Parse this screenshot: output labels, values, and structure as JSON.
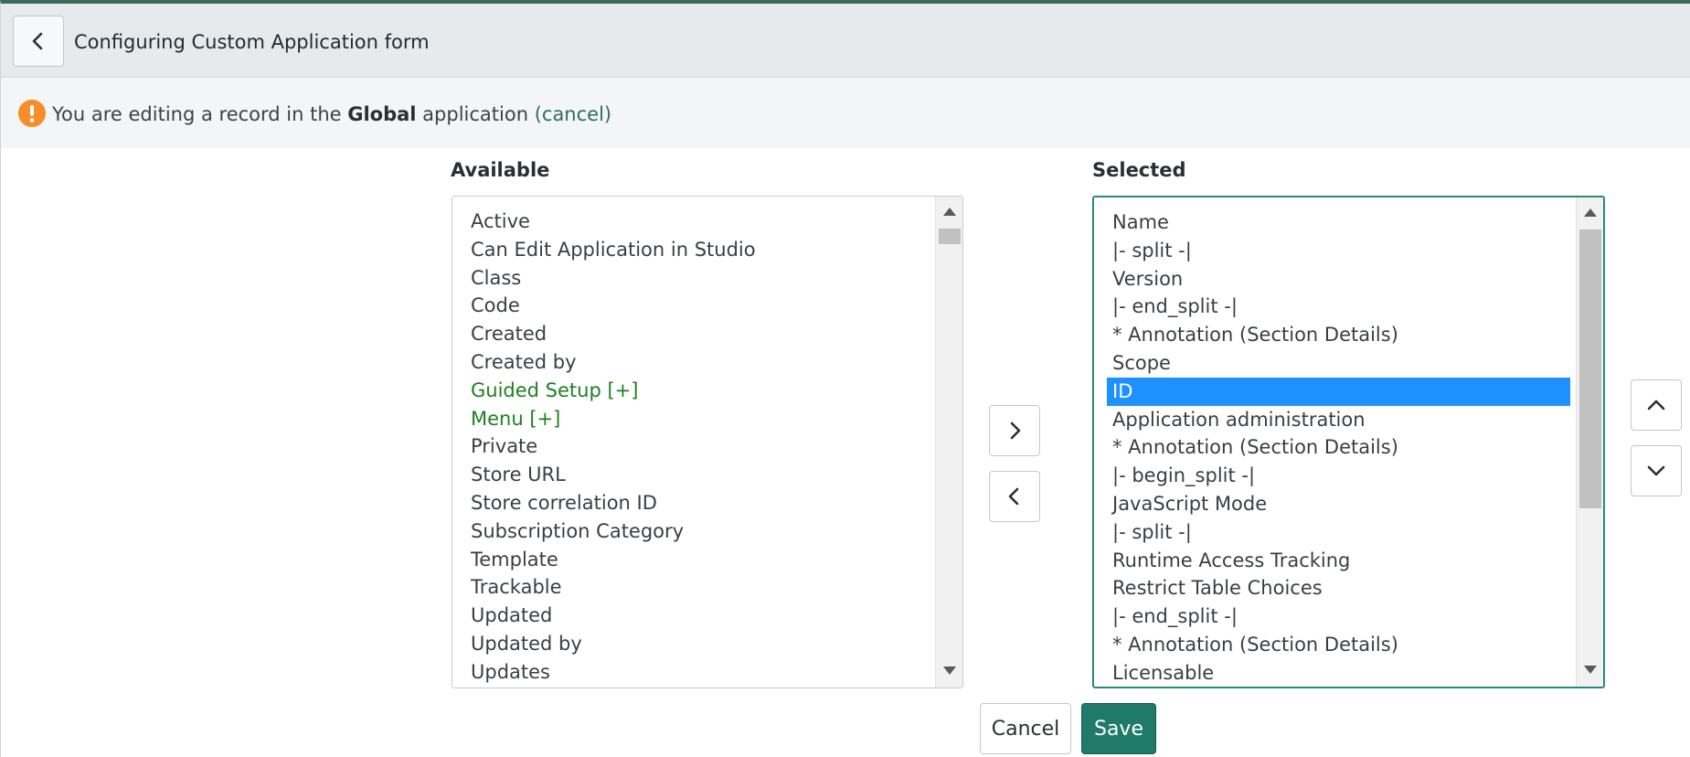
{
  "header": {
    "title": "Configuring Custom Application form"
  },
  "banner": {
    "prefix": "You are editing a record in the ",
    "app_name": "Global",
    "suffix": " application ",
    "cancel_link": "(cancel)"
  },
  "available": {
    "label": "Available",
    "items": [
      {
        "text": "Active"
      },
      {
        "text": "Can Edit Application in Studio"
      },
      {
        "text": "Class"
      },
      {
        "text": "Code"
      },
      {
        "text": "Created"
      },
      {
        "text": "Created by"
      },
      {
        "text": "Guided Setup [+]",
        "color": "#1f7f1f"
      },
      {
        "text": "Menu [+]",
        "color": "#1f7f1f"
      },
      {
        "text": "Private"
      },
      {
        "text": "Store URL"
      },
      {
        "text": "Store correlation ID"
      },
      {
        "text": "Subscription Category"
      },
      {
        "text": "Template"
      },
      {
        "text": "Trackable"
      },
      {
        "text": "Updated"
      },
      {
        "text": "Updated by"
      },
      {
        "text": "Updates"
      }
    ]
  },
  "selected": {
    "label": "Selected",
    "selected_item": "ID",
    "items": [
      {
        "text": "Name"
      },
      {
        "text": "|- split -|"
      },
      {
        "text": "Version"
      },
      {
        "text": "|- end_split -|"
      },
      {
        "text": "* Annotation (Section Details)"
      },
      {
        "text": "Scope"
      },
      {
        "text": "ID"
      },
      {
        "text": "Application administration"
      },
      {
        "text": "* Annotation (Section Details)"
      },
      {
        "text": "|- begin_split -|"
      },
      {
        "text": "JavaScript Mode"
      },
      {
        "text": "|- split -|"
      },
      {
        "text": "Runtime Access Tracking"
      },
      {
        "text": "Restrict Table Choices"
      },
      {
        "text": "|- end_split -|"
      },
      {
        "text": "* Annotation (Section Details)"
      },
      {
        "text": "Licensable"
      }
    ]
  },
  "buttons": {
    "cancel_label": "Cancel",
    "save_label": "Save"
  },
  "icons": {
    "back": "chevron-left-icon",
    "warning": "exclamation-icon",
    "add": "chevron-right-icon",
    "remove": "chevron-left-icon",
    "move_up": "chevron-up-icon",
    "move_down": "chevron-down-icon"
  },
  "colors": {
    "accent": "#1f7a69",
    "selection": "#1f90ff",
    "warning": "#f78d2a",
    "link": "#2d6e5e",
    "container_field": "#1f7f1f"
  }
}
